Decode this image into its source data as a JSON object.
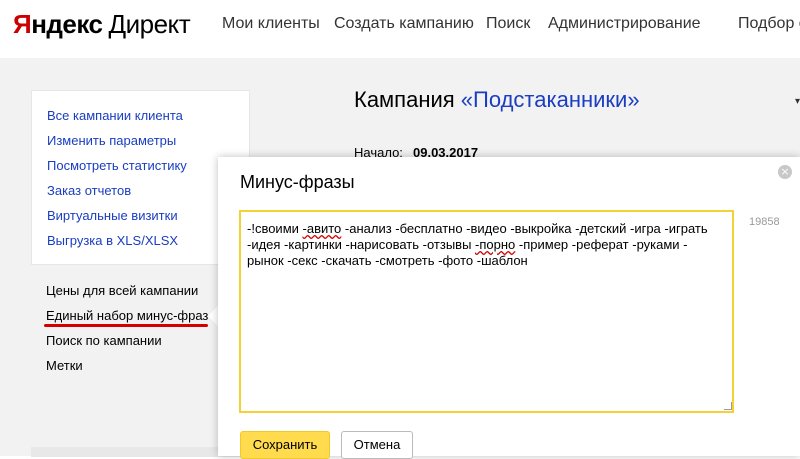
{
  "header": {
    "logo_ya": "Я",
    "logo_rest": "ндекс",
    "logo_direct": "Директ",
    "nav": [
      {
        "label": "Мои клиенты"
      },
      {
        "label": "Создать кампанию"
      },
      {
        "label": "Поиск"
      },
      {
        "label": "Администрирование"
      },
      {
        "label": "Подбор с"
      }
    ]
  },
  "sidebar": {
    "group1": [
      {
        "label": "Все кампании клиента"
      },
      {
        "label": "Изменить параметры"
      },
      {
        "label": "Посмотреть статистику"
      },
      {
        "label": "Заказ отчетов"
      },
      {
        "label": "Виртуальные визитки"
      },
      {
        "label": "Выгрузка в XLS/XLSX"
      }
    ],
    "group2": [
      {
        "label": "Цены для всей кампании"
      },
      {
        "label": "Единый набор минус-фраз"
      },
      {
        "label": "Поиск по кампании"
      },
      {
        "label": "Метки"
      }
    ]
  },
  "main": {
    "title_prefix": "Кампания ",
    "campaign_name": "«Подстаканники»",
    "start_label": "Начало:",
    "start_value": "09.03.2017"
  },
  "popup": {
    "title": "Минус-фразы",
    "close_glyph": "×",
    "text_line1_a": "-!своими ",
    "text_line1_b": "-авито",
    "text_line1_c": " -анализ -бесплатно -видео -выкройка -детский -игра -играть",
    "text_line2_a": "-идея -картинки -нарисовать -отзывы ",
    "text_line2_b": "-порно",
    "text_line2_c": " -пример -реферат -руками -",
    "text_line3": "рынок -секс -скачать -смотреть -фото -шаблон",
    "counter": "19858",
    "save_label": "Сохранить",
    "cancel_label": "Отмена"
  },
  "colors": {
    "accent": "#ffdb4d",
    "link": "#1a3dc1",
    "brand_red": "#cc0000",
    "highlight_red": "#d40000"
  }
}
